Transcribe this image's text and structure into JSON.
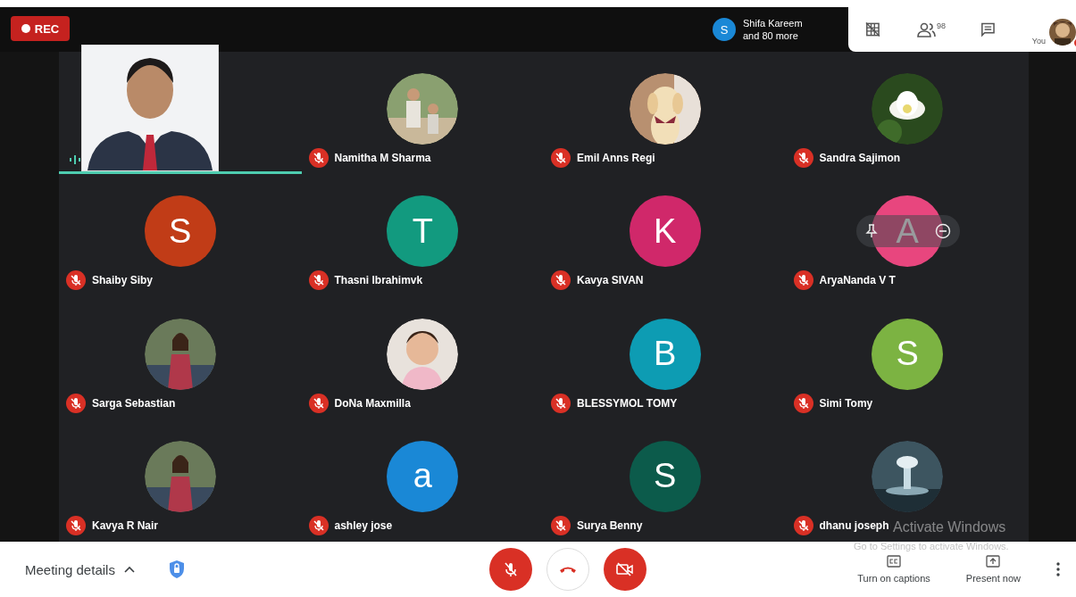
{
  "recording": {
    "label": "REC"
  },
  "participants_chip": {
    "initial": "S",
    "line1": "Shifa Kareem",
    "line2": "and 80 more"
  },
  "toolbar": {
    "people_count": "98",
    "self_label": "You"
  },
  "main_tile": {
    "speaking": true
  },
  "tiles": [
    {
      "name": "Namitha M Sharma",
      "muted": true,
      "hover": false
    },
    {
      "name": "Emil Anns Regi",
      "muted": true,
      "hover": false
    },
    {
      "name": "Sandra Sajimon",
      "muted": true,
      "hover": false
    },
    {
      "name": "Shaiby Siby",
      "kind": "letter",
      "initial": "S",
      "color": "#c13c17",
      "muted": true,
      "hover": false
    },
    {
      "name": "Thasni Ibrahimvk",
      "kind": "letter",
      "initial": "T",
      "color": "#129a7f",
      "muted": true,
      "hover": false
    },
    {
      "name": "Kavya SIVAN",
      "kind": "letter",
      "initial": "K",
      "color": "#d0286a",
      "muted": true,
      "hover": false
    },
    {
      "name": "AryaNanda V T",
      "kind": "letter",
      "initial": "A",
      "color": "#e8467e",
      "muted": true,
      "hover": true
    },
    {
      "name": "Sarga Sebastian",
      "muted": true,
      "hover": false
    },
    {
      "name": "DoNa Maxmilla",
      "muted": true,
      "hover": false
    },
    {
      "name": "BLESSYMOL TOMY",
      "kind": "letter",
      "initial": "B",
      "color": "#0d9cb3",
      "muted": true,
      "hover": false
    },
    {
      "name": "Simi Tomy",
      "kind": "letter",
      "initial": "S",
      "color": "#7cb342",
      "muted": true,
      "hover": false
    },
    {
      "name": "Kavya R Nair",
      "muted": true,
      "hover": false
    },
    {
      "name": "ashley jose",
      "kind": "letter",
      "initial": "a",
      "color": "#1a88d6",
      "muted": true,
      "hover": false
    },
    {
      "name": "Surya Benny",
      "kind": "letter",
      "initial": "S",
      "color": "#0c5b4b",
      "muted": true,
      "hover": false
    },
    {
      "name": "dhanu joseph",
      "muted": true,
      "hover": false
    }
  ],
  "bottom_bar": {
    "meeting_details": "Meeting details",
    "captions": "Turn on captions",
    "present": "Present now"
  },
  "windows_notice": {
    "title": "Activate Windows",
    "message": "Go to Settings to activate Windows."
  }
}
